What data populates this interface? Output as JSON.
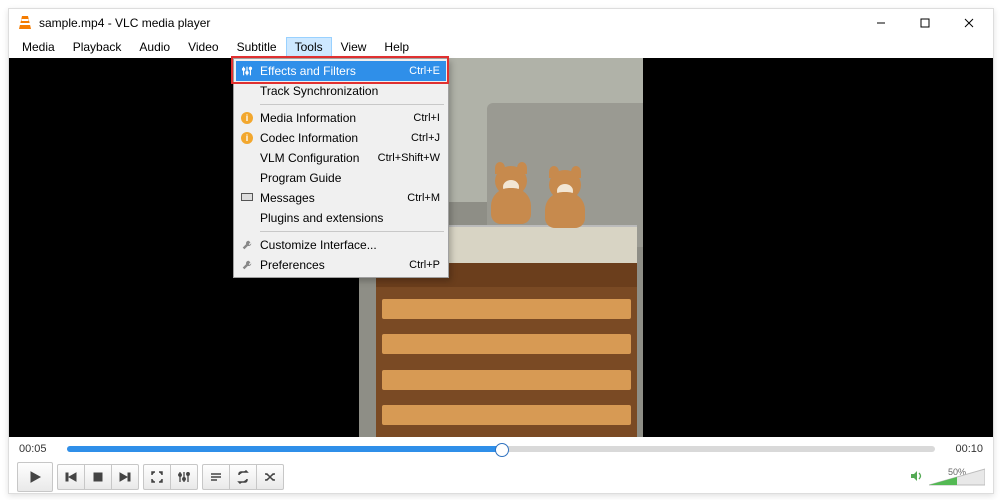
{
  "title": "sample.mp4 - VLC media player",
  "menubar": [
    "Media",
    "Playback",
    "Audio",
    "Video",
    "Subtitle",
    "Tools",
    "View",
    "Help"
  ],
  "menubar_open_index": 5,
  "tools_menu": [
    {
      "icon": "sliders",
      "label": "Effects and Filters",
      "accel": "Ctrl+E",
      "hover": true
    },
    {
      "icon": "",
      "label": "Track Synchronization",
      "accel": ""
    },
    {
      "sep": true
    },
    {
      "icon": "info",
      "label": "Media Information",
      "accel": "Ctrl+I"
    },
    {
      "icon": "info",
      "label": "Codec Information",
      "accel": "Ctrl+J"
    },
    {
      "icon": "",
      "label": "VLM Configuration",
      "accel": "Ctrl+Shift+W"
    },
    {
      "icon": "",
      "label": "Program Guide",
      "accel": ""
    },
    {
      "icon": "msg",
      "label": "Messages",
      "accel": "Ctrl+M"
    },
    {
      "icon": "",
      "label": "Plugins and extensions",
      "accel": ""
    },
    {
      "sep": true
    },
    {
      "icon": "wrench",
      "label": "Customize Interface...",
      "accel": ""
    },
    {
      "icon": "wrench",
      "label": "Preferences",
      "accel": "Ctrl+P"
    }
  ],
  "time_current": "00:05",
  "time_total": "00:10",
  "seek_percent": 50,
  "volume_label": "50%",
  "volume_percent": 50
}
